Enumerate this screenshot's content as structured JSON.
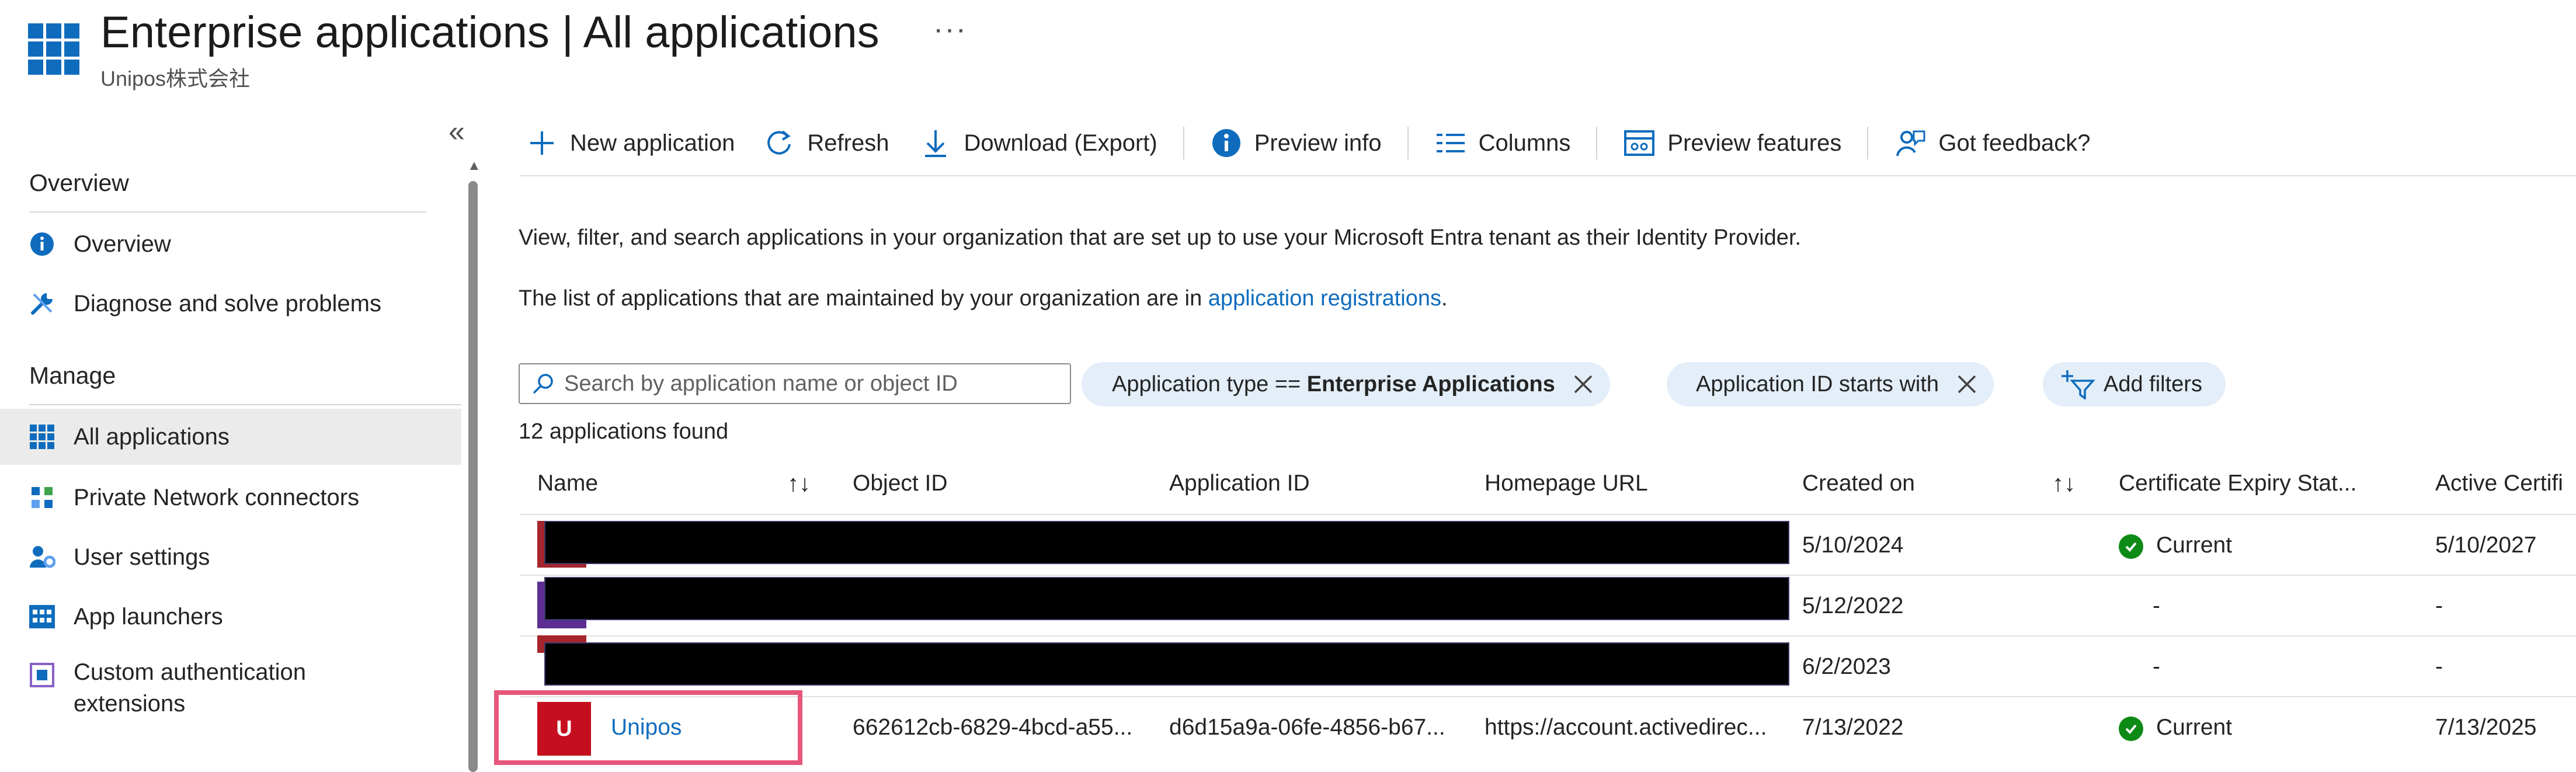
{
  "header": {
    "title_main": "Enterprise applications",
    "title_sep": "|",
    "title_sub": "All applications",
    "tenant": "Unipos株式会社",
    "more": "···"
  },
  "sidebar": {
    "collapse_label": "«",
    "sections": [
      {
        "title": "Overview",
        "items": [
          {
            "label": "Overview",
            "icon": "info-icon"
          },
          {
            "label": "Diagnose and solve problems",
            "icon": "wrench-icon"
          }
        ]
      },
      {
        "title": "Manage",
        "items": [
          {
            "label": "All applications",
            "icon": "apps-grid-icon",
            "selected": true
          },
          {
            "label": "Private Network connectors",
            "icon": "network-connector-icon"
          },
          {
            "label": "User settings",
            "icon": "user-settings-icon"
          },
          {
            "label": "App launchers",
            "icon": "app-launcher-icon"
          },
          {
            "label": "Custom authentication",
            "label2": "extensions",
            "icon": "custom-auth-icon"
          }
        ]
      }
    ]
  },
  "toolbar": {
    "new_application": "New application",
    "refresh": "Refresh",
    "download": "Download (Export)",
    "preview_info": "Preview info",
    "columns": "Columns",
    "preview_features": "Preview features",
    "feedback": "Got feedback?"
  },
  "description": {
    "line1": "View, filter, and search applications in your organization that are set up to use your Microsoft Entra tenant as their Identity Provider.",
    "line2_prefix": "The list of applications that are maintained by your organization are in ",
    "line2_link": "application registrations",
    "line2_suffix": "."
  },
  "filters": {
    "search_placeholder": "Search by application name or object ID",
    "pill1_prefix": "Application type == ",
    "pill1_value": "Enterprise Applications",
    "pill2": "Application ID starts with",
    "add_filters": "Add filters"
  },
  "results_count": "12 applications found",
  "table": {
    "columns": {
      "name": "Name",
      "object_id": "Object ID",
      "application_id": "Application ID",
      "homepage_url": "Homepage URL",
      "created_on": "Created on",
      "cert_status": "Certificate Expiry Stat...",
      "active_cert": "Active Certifi"
    },
    "sort_glyph": "↑↓",
    "rows": [
      {
        "name": "",
        "created_on": "5/10/2024",
        "cert_status": "Current",
        "cert_ok": true,
        "active_cert": "5/10/2027",
        "redacted": true
      },
      {
        "name": "",
        "created_on": "5/12/2022",
        "cert_status": "-",
        "cert_ok": false,
        "active_cert": "-",
        "redacted": true
      },
      {
        "name": "",
        "created_on": "6/2/2023",
        "cert_status": "-",
        "cert_ok": false,
        "active_cert": "-",
        "redacted": true
      },
      {
        "avatar_letter": "U",
        "name": "Unipos",
        "object_id": "662612cb-6829-4bcd-a55...",
        "application_id": "d6d15a9a-06fe-4856-b67...",
        "homepage_url": "https://account.activedirec...",
        "created_on": "7/13/2022",
        "cert_status": "Current",
        "cert_ok": true,
        "active_cert": "7/13/2025",
        "redacted": false
      }
    ]
  },
  "colors": {
    "accent": "#0f6cbd",
    "pill_bg": "#e3eef8",
    "status_ok": "#0e8a16",
    "avatar": "#c50f1f",
    "highlight": "#e6577a"
  }
}
